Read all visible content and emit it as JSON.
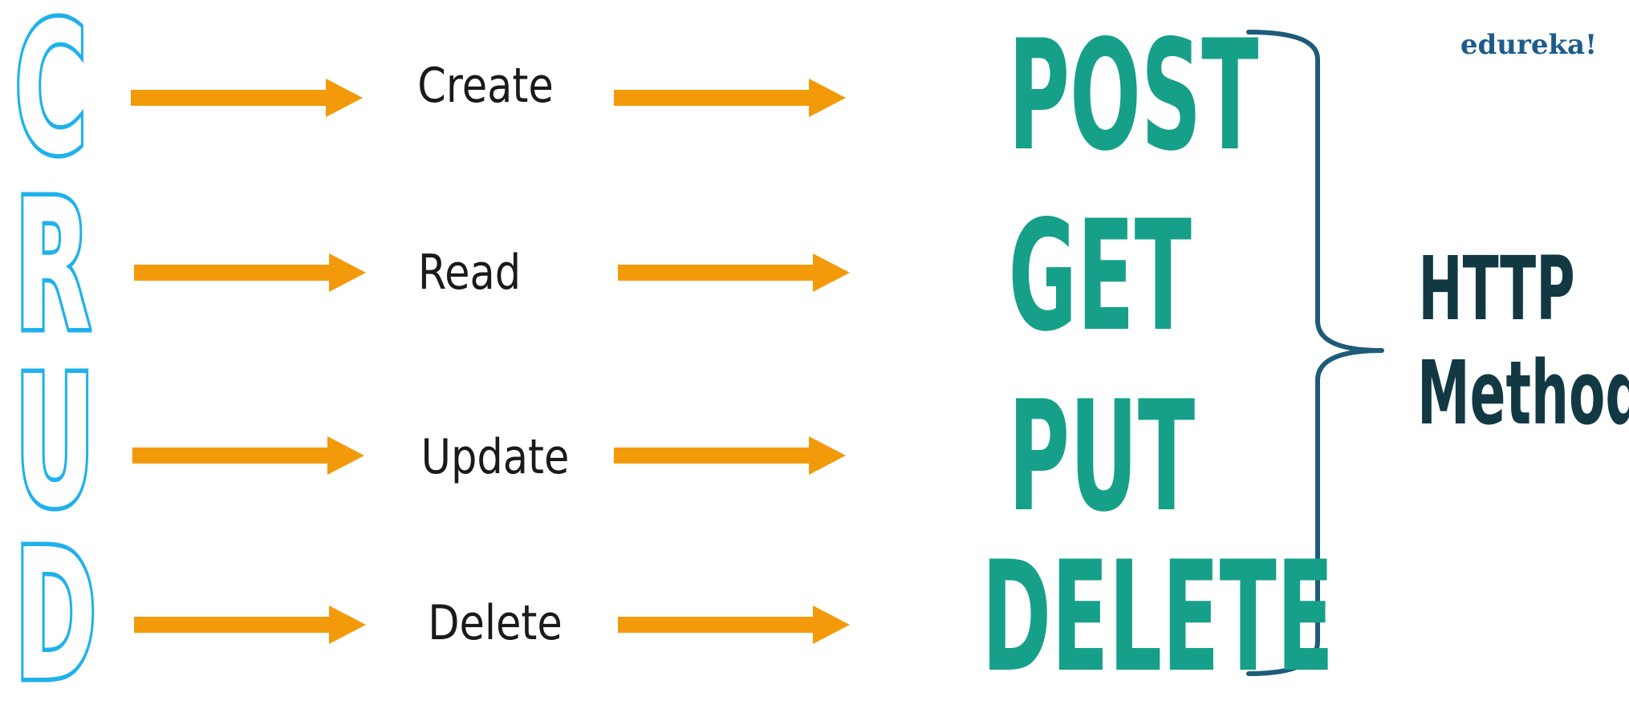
{
  "crud_letters": [
    "C",
    "R",
    "U",
    "D"
  ],
  "operations": [
    "Create",
    "Read",
    "Update",
    "Delete"
  ],
  "http_methods": [
    "POST",
    "GET",
    "PUT",
    "DELETE"
  ],
  "group_label": {
    "line1": "HTTP",
    "line2": "Methods"
  },
  "logo": "edureka!",
  "colors": {
    "crud_outline": "#1fb1ec",
    "arrow": "#f39a0b",
    "method": "#16a08a",
    "bracket": "#1e5a7a",
    "group_label": "#123844",
    "logo": "#1c5c8c"
  }
}
